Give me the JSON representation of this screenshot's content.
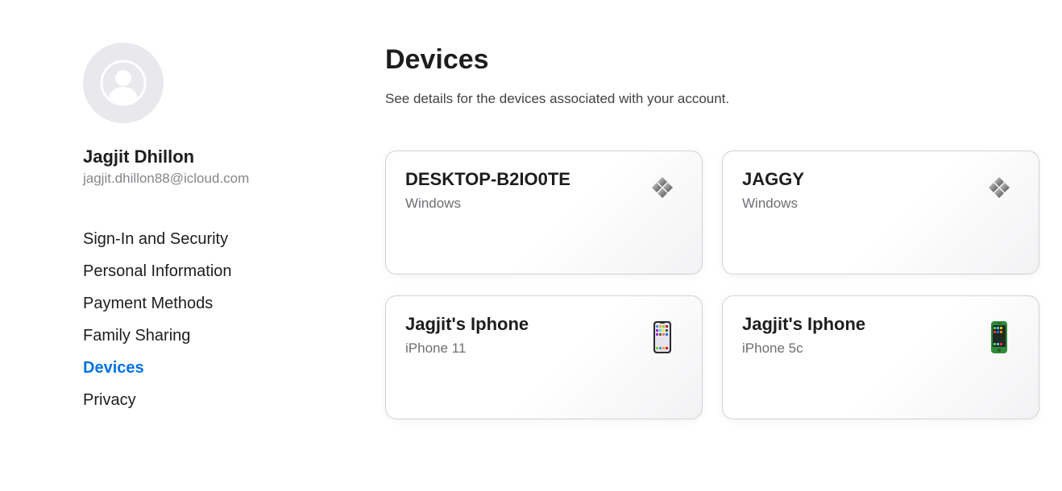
{
  "user": {
    "name": "Jagjit Dhillon",
    "email": "jagjit.dhillon88@icloud.com"
  },
  "nav": {
    "items": [
      {
        "label": "Sign-In and Security"
      },
      {
        "label": "Personal Information"
      },
      {
        "label": "Payment Methods"
      },
      {
        "label": "Family Sharing"
      },
      {
        "label": "Devices",
        "active": true
      },
      {
        "label": "Privacy"
      }
    ]
  },
  "main": {
    "title": "Devices",
    "subtitle": "See details for the devices associated with your account."
  },
  "devices": [
    {
      "name": "DESKTOP-B2IO0TE",
      "model": "Windows",
      "icon": "windows-pc-icon"
    },
    {
      "name": "JAGGY",
      "model": "Windows",
      "icon": "windows-pc-icon"
    },
    {
      "name": "Jagjit's Iphone",
      "model": "iPhone 11",
      "icon": "iphone-11-icon"
    },
    {
      "name": "Jagjit's Iphone",
      "model": "iPhone 5c",
      "icon": "iphone-5c-icon"
    }
  ],
  "colors": {
    "accent": "#0071e3",
    "text_primary": "#1d1d1f",
    "text_secondary": "#6e6e73",
    "avatar_bg": "#e8e8ed",
    "card_border": "#d2d2d7"
  }
}
